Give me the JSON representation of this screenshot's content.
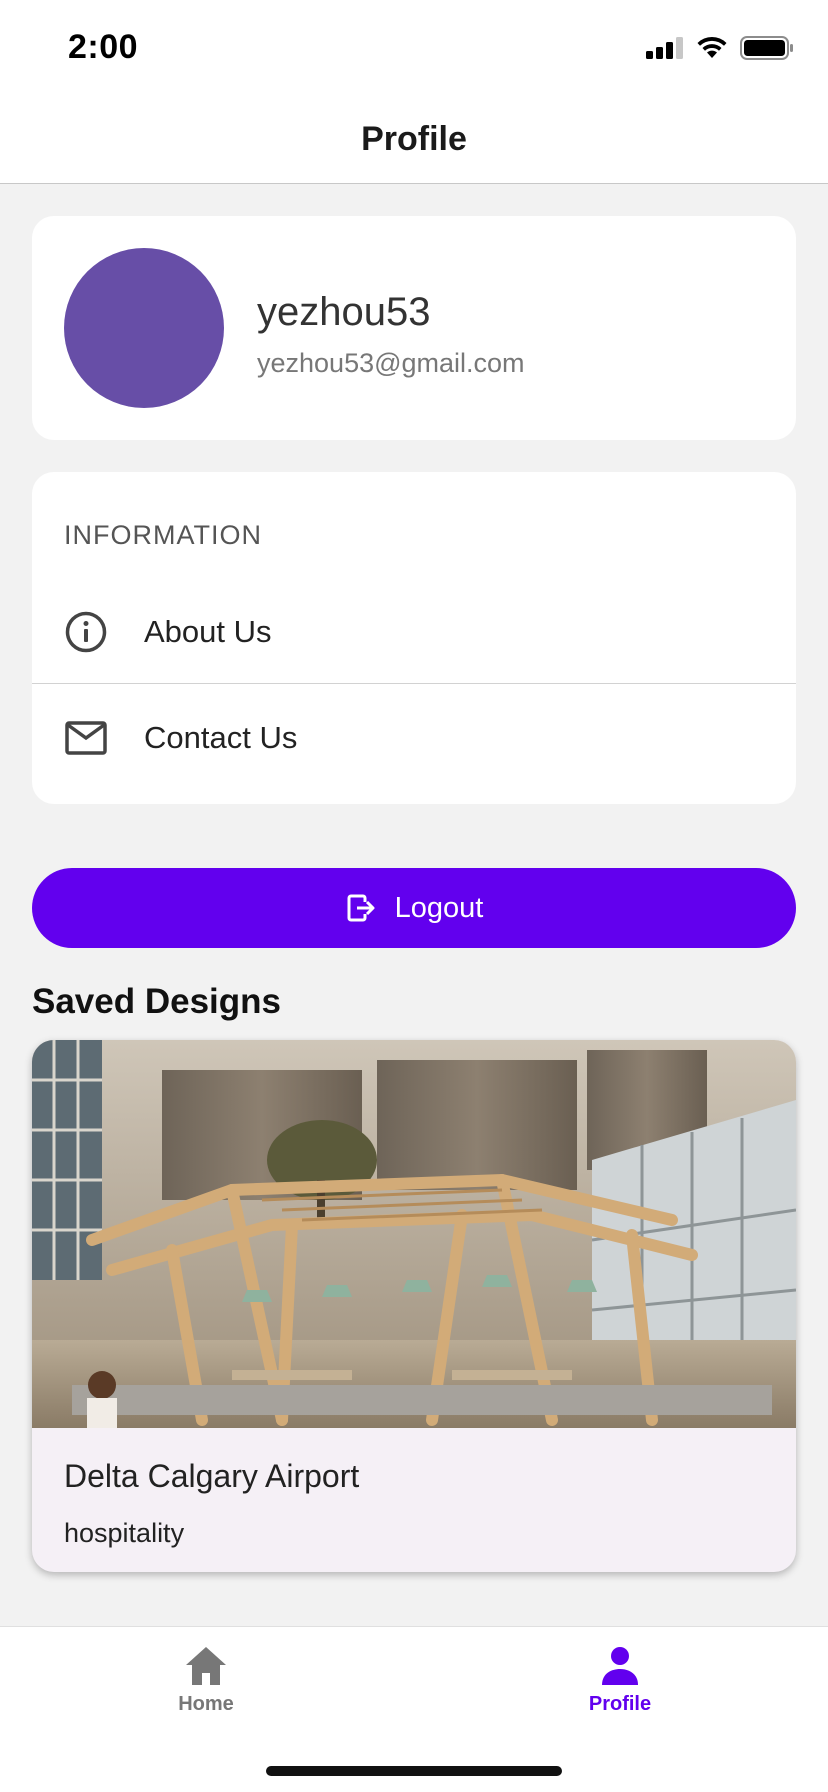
{
  "status_bar": {
    "time": "2:00"
  },
  "header": {
    "title": "Profile"
  },
  "profile": {
    "username": "yezhou53",
    "email": "yezhou53@gmail.com",
    "avatar_color": "#674ea7"
  },
  "information": {
    "heading": "INFORMATION",
    "items": [
      {
        "label": "About Us",
        "icon": "info-icon"
      },
      {
        "label": "Contact Us",
        "icon": "mail-icon"
      }
    ]
  },
  "logout": {
    "label": "Logout",
    "icon": "logout-icon",
    "color": "#6200ee"
  },
  "saved_designs": {
    "title": "Saved Designs",
    "items": [
      {
        "name": "Delta Calgary Airport",
        "category": "hospitality"
      }
    ]
  },
  "tabs": [
    {
      "label": "Home",
      "icon": "home-icon",
      "active": false
    },
    {
      "label": "Profile",
      "icon": "person-icon",
      "active": true
    }
  ],
  "colors": {
    "accent": "#6200ee",
    "inactive_tab": "#777777"
  }
}
